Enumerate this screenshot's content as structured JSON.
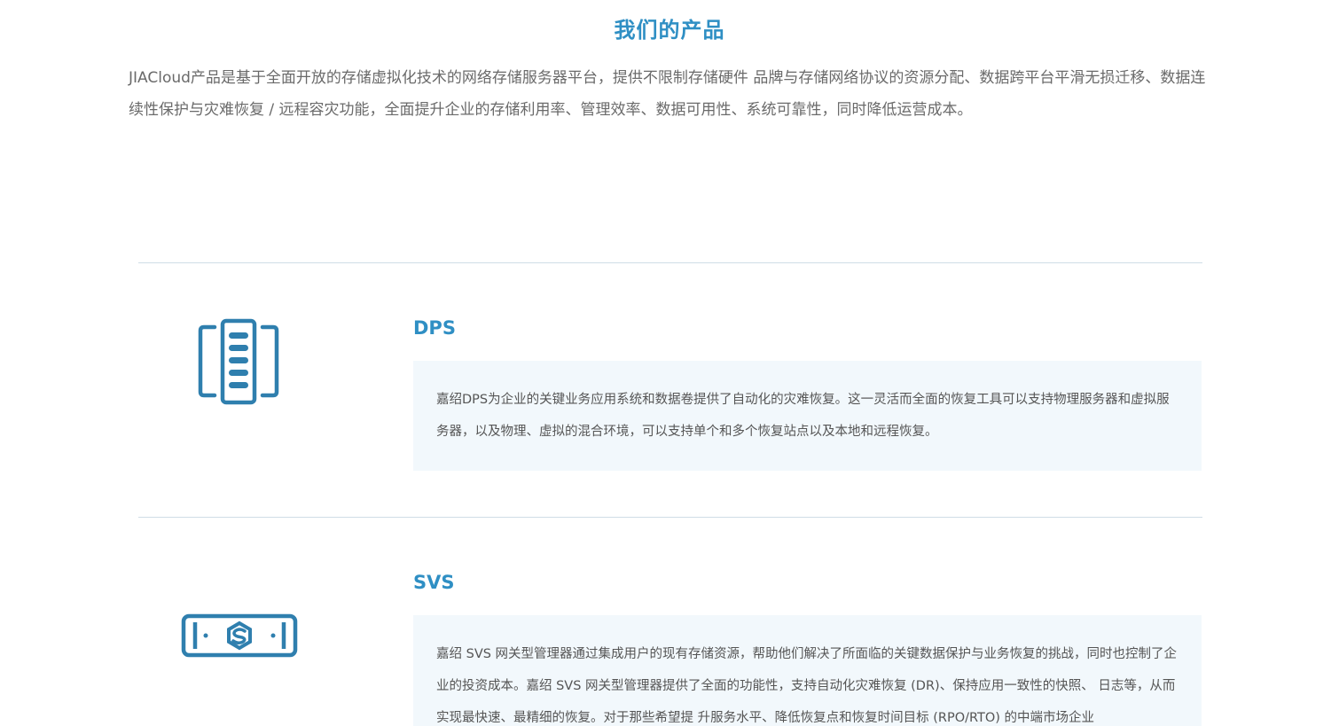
{
  "section": {
    "title": "我们的产品",
    "intro": "JIACloud产品是基于全面开放的存储虚拟化技术的网络存储服务器平台，提供不限制存储硬件 品牌与存储网络协议的资源分配、数据跨平台平滑无损迁移、数据连续性保护与灾难恢复 / 远程容灾功能，全面提升企业的存储利用率、管理效率、数据可用性、系统可靠性，同时降低运营成本。"
  },
  "products": [
    {
      "name": "DPS",
      "icon": "server-rack-icon",
      "description": "嘉绍DPS为企业的关键业务应用系统和数据卷提供了自动化的灾难恢复。这一灵活而全面的恢复工具可以支持物理服务器和虚拟服务器，以及物理、虚拟的混合环境，可以支持单个和多个恢复站点以及本地和远程恢复。"
    },
    {
      "name": "SVS",
      "icon": "gateway-appliance-icon",
      "description": "嘉绍 SVS 网关型管理器通过集成用户的现有存储资源，帮助他们解决了所面临的关键数据保护与业务恢复的挑战，同时也控制了企业的投资成本。嘉绍 SVS 网关型管理器提供了全面的功能性，支持自动化灾难恢复 (DR)、保持应用一致性的快照、 日志等，从而实现最快速、最精细的恢复。对于那些希望提 升服务水平、降低恢复点和恢复时间目标 (RPO/RTO) 的中端市场企业"
    }
  ],
  "colors": {
    "accent": "#2f8fc4",
    "box_background": "#f2f8fc",
    "divider": "#cfdde6",
    "text": "#555555"
  }
}
